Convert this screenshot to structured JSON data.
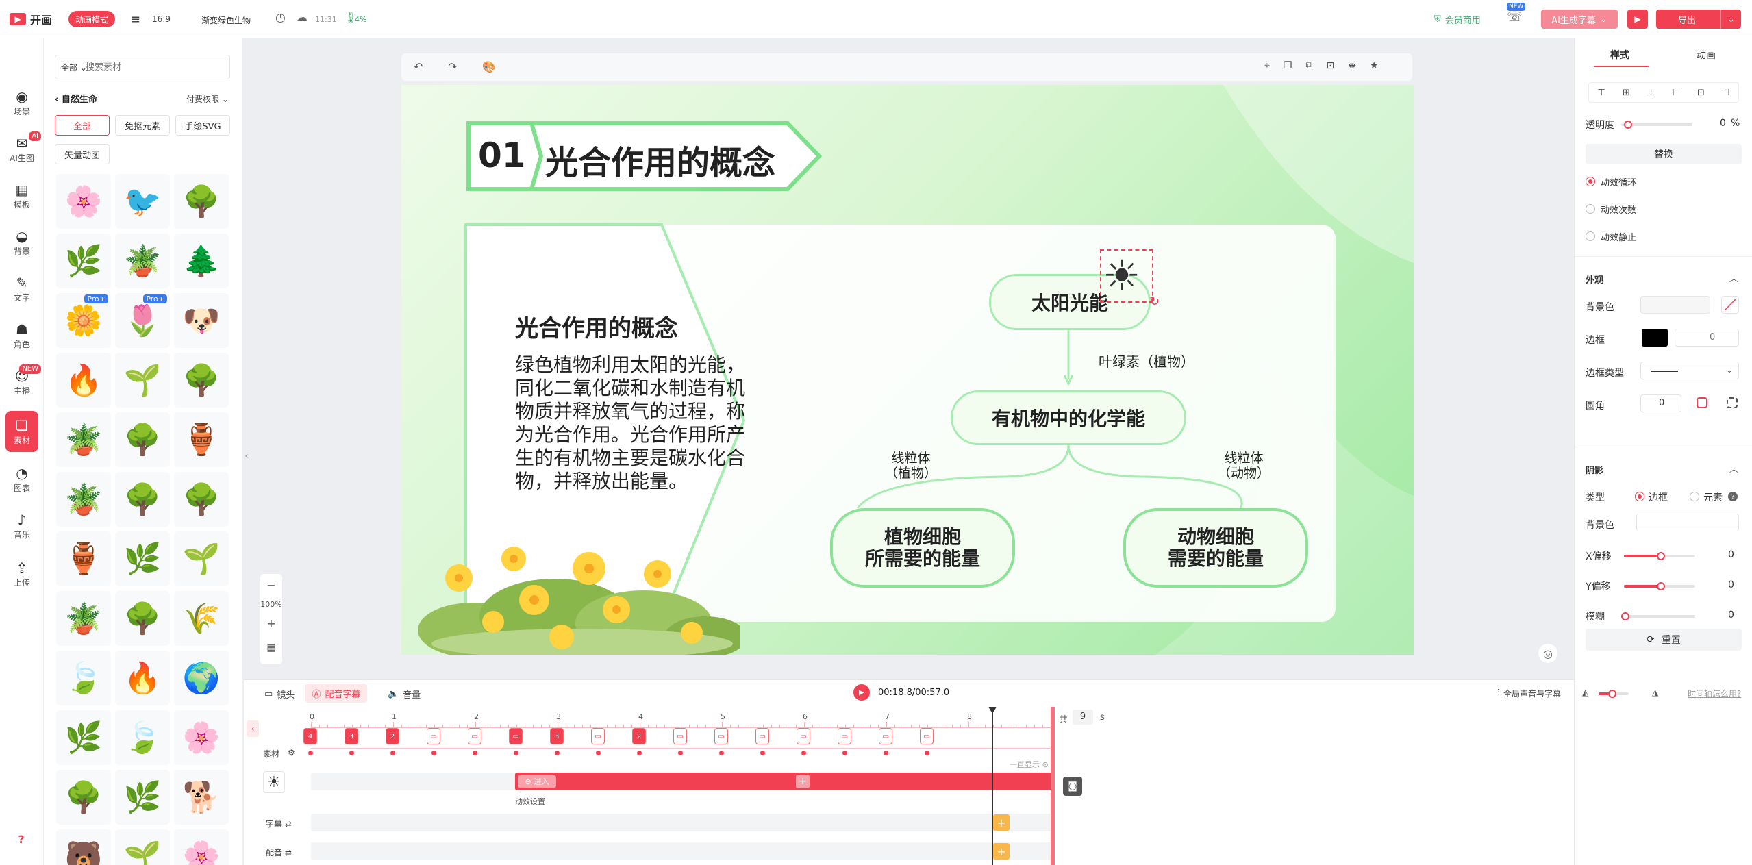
{
  "app": {
    "logo": "开画",
    "mode_badge": "动画模式",
    "ratio": "16:9",
    "project_name": "渐变绿色生物",
    "save_time": "11:31",
    "progress": "4%",
    "vip_link": "会员商用",
    "new_tag": "NEW",
    "ai_subtitle": "AI生成字幕",
    "export": "导出"
  },
  "rail": [
    {
      "label": "场景",
      "icon": "scene-icon",
      "glyph": "◉"
    },
    {
      "label": "AI生图",
      "icon": "ai-image-icon",
      "glyph": "✉",
      "badge": "AI"
    },
    {
      "label": "模板",
      "icon": "template-icon",
      "glyph": "▦"
    },
    {
      "label": "背景",
      "icon": "background-icon",
      "glyph": "◒"
    },
    {
      "label": "文字",
      "icon": "text-icon",
      "glyph": "✎"
    },
    {
      "label": "角色",
      "icon": "character-icon",
      "glyph": "☗"
    },
    {
      "label": "主播",
      "icon": "anchor-icon",
      "glyph": "☺",
      "badge": "NEW"
    },
    {
      "label": "素材",
      "icon": "material-icon",
      "glyph": "❏"
    },
    {
      "label": "图表",
      "icon": "chart-icon",
      "glyph": "◔"
    },
    {
      "label": "音乐",
      "icon": "music-icon",
      "glyph": "♪"
    },
    {
      "label": "上传",
      "icon": "upload-icon",
      "glyph": "⇪"
    }
  ],
  "help": "?",
  "assets": {
    "scope": "全部",
    "search_placeholder": "搜索素材",
    "category": "自然生命",
    "permission": "付费权限",
    "filters": [
      "全部",
      "免抠元素",
      "手绘SVG",
      "矢量动图"
    ],
    "pro_tag": "Pro+",
    "tiles": [
      "🌸",
      "🐦",
      "🌳",
      "🌿",
      "🪴",
      "🌲",
      "🌼",
      "🌷",
      "🐶",
      "🔥",
      "🌱",
      "🌳",
      "🪴",
      "🌳",
      "🏺",
      "🪴",
      "🌳",
      "🌳",
      "🏺",
      "🌿",
      "🌱",
      "🪴",
      "🌳",
      "🌾",
      "🍃",
      "🔥",
      "🌍",
      "🌿",
      "🍃",
      "🌸",
      "🌳",
      "🌿",
      "🐕",
      "🐻",
      "🌱",
      "🌸"
    ],
    "tile_names": [
      "flowers-tile",
      "swallow-tile",
      "bonsai-tile",
      "bush-tile",
      "potted-plant-tile",
      "tree-tile",
      "flower-row-tile",
      "lavender-tile",
      "dog-tile",
      "flame-tile",
      "hedge-tile",
      "green-tree-tile",
      "potted-plant-tile",
      "trees-tile",
      "plant-stand-tile",
      "vase-plant-tile",
      "yellow-tree-tile",
      "bush-tree-tile",
      "flower-vase-tile",
      "leaves-tile",
      "sprout-tile",
      "grass-pot-tile",
      "round-tree-tile",
      "grass-lines-tile",
      "leaf-tile",
      "fire-tile",
      "earth-tile",
      "shrub-tile",
      "green-leaf-tile",
      "pink-petals-tile",
      "tree-tile",
      "twigs-tile",
      "corgi-tile",
      "bear-tile",
      "plant-tile",
      "pink-flower-tile"
    ]
  },
  "canvas": {
    "heading_num": "01",
    "heading_title": "光合作用的概念",
    "body_title": "光合作用的概念",
    "body_text": "绿色植物利用太阳的光能，同化二氧化碳和水制造有机物质并释放氧气的过程，称为光合作用。光合作用所产生的有机物主要是碳水化合物，并释放出能量。",
    "node_sun": "太阳光能",
    "label_chloro": "叶绿素（植物）",
    "node_organic": "有机物中的化学能",
    "label_plant": "线粒体\n（植物）",
    "label_animal": "线粒体\n（动物）",
    "node_plant": "植物细胞\n所需要的能量",
    "node_animal": "动物细胞\n需要的能量",
    "zoom": "100%"
  },
  "right": {
    "tab_style": "样式",
    "tab_anim": "动画",
    "opacity_label": "透明度",
    "opacity_value": "0",
    "opacity_unit": "%",
    "replace": "替换",
    "loop_options": [
      "动效循环",
      "动效次数",
      "动效静止"
    ],
    "appearance": "外观",
    "bg_color": "背景色",
    "border": "边框",
    "border_value": "0",
    "border_type": "边框类型",
    "radius": "圆角",
    "radius_value": "0",
    "shadow": "阴影",
    "type": "类型",
    "type_border": "边框",
    "type_element": "元素",
    "shadow_bg": "背景色",
    "x_offset": "X偏移",
    "x_value": "0",
    "y_offset": "Y偏移",
    "y_value": "0",
    "blur": "模糊",
    "blur_value": "0",
    "reset": "重置"
  },
  "timeline": {
    "tab_camera": "镜头",
    "tab_subtitle": "配音字幕",
    "tab_volume": "音量",
    "time": "00:18.8/00:57.0",
    "global_voice": "全局声音与字幕",
    "help_link": "时间轴怎么用?",
    "total_label": "共",
    "total_value": "9",
    "total_unit": "s",
    "ticks": [
      "0",
      "1",
      "2",
      "3",
      "4",
      "5",
      "6",
      "7",
      "8"
    ],
    "track_material": "素材",
    "always_show": "一直显示",
    "clip_enter": "进入",
    "anim_settings": "动效设置",
    "track_subtitle": "字幕",
    "track_voice": "配音",
    "clip_labels": [
      "4",
      "3",
      "2",
      "",
      "",
      "",
      "3",
      "",
      "2",
      "",
      "",
      "",
      "",
      "",
      "",
      "",
      ""
    ]
  }
}
